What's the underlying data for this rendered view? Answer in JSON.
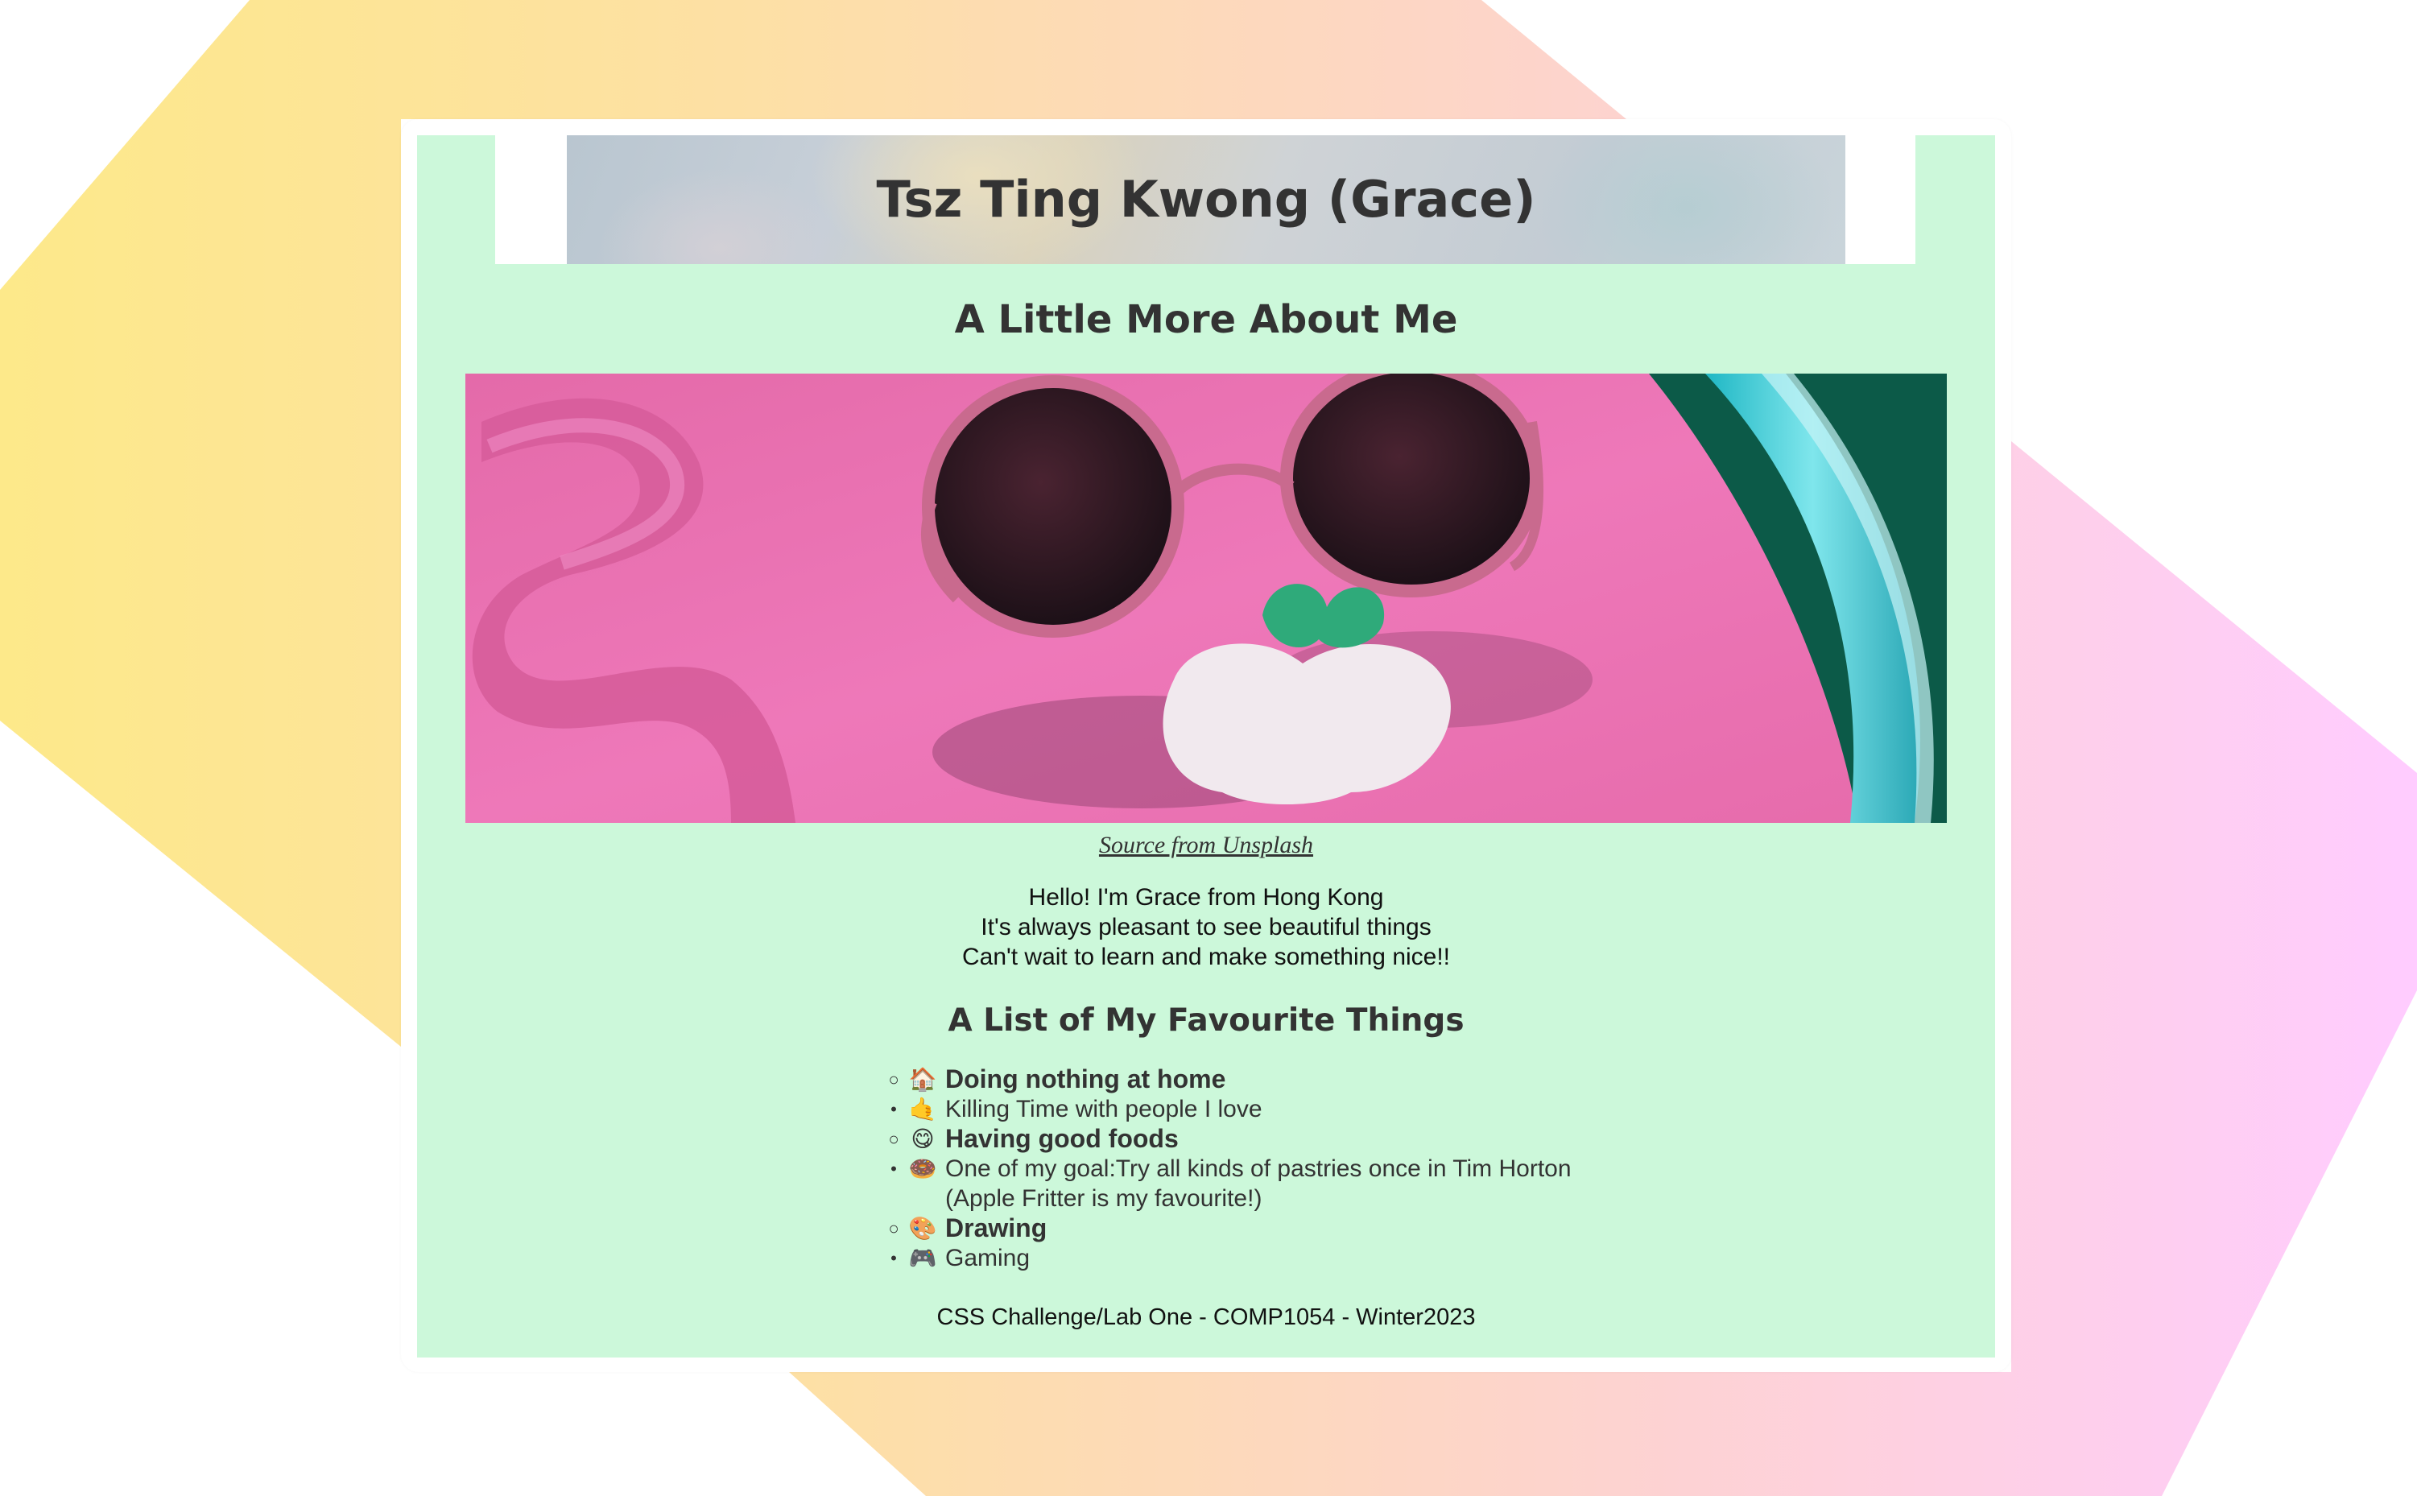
{
  "page": {
    "colors": {
      "content_bg": "#ccf8da",
      "card_bg": "#ffffff",
      "text": "#333333",
      "bg_band_left": "#fde98a",
      "bg_band_mid": "#fdd5c2",
      "bg_band_right": "#ffccff"
    }
  },
  "header": {
    "title": "Tsz Ting Kwong (Grace)"
  },
  "about": {
    "title": "A Little More About Me",
    "image_caption": "Source from Unsplash",
    "intro_lines": [
      "Hello! I'm Grace from Hong Kong",
      "It's always pleasant to see beautiful things",
      "Can't wait to learn and make something nice!!"
    ]
  },
  "favourites": {
    "title": "A List of My Favourite Things",
    "items": [
      {
        "marker": "○",
        "emoji": "🏠",
        "emoji_name": "house-icon",
        "text": "Doing nothing at home",
        "bold": true
      },
      {
        "marker": "•",
        "emoji": "🤙",
        "emoji_name": "hand-icon",
        "text": "Killing Time with people I love",
        "bold": false
      },
      {
        "marker": "○",
        "emoji": "😋",
        "emoji_name": "yummy-face-icon",
        "text": "Having good foods",
        "bold": true
      },
      {
        "marker": "•",
        "emoji": "🍩",
        "emoji_name": "donut-icon",
        "text": "One of my goal:Try all kinds of pastries once in Tim Horton",
        "text2": "(Apple Fritter is my favourite!)",
        "bold": false
      },
      {
        "marker": "○",
        "emoji": "🎨",
        "emoji_name": "palette-icon",
        "text": "Drawing",
        "bold": true
      },
      {
        "marker": "•",
        "emoji": "🎮",
        "emoji_name": "gamepad-icon",
        "text": "Gaming",
        "bold": false
      }
    ]
  },
  "footer": {
    "text": "CSS Challenge/Lab One - COMP1054 - Winter2023"
  }
}
